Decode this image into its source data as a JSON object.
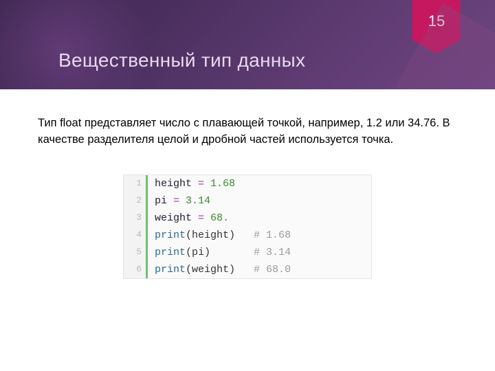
{
  "page_number": "15",
  "title": "Вещественный тип данных",
  "paragraph": "Тип float представляет число с плавающей точкой, например, 1.2 или 34.76. В качестве разделителя целой и дробной частей используется точка.",
  "code": {
    "lines": [
      {
        "n": "1",
        "t": [
          {
            "c": "tk-n",
            "s": "height "
          },
          {
            "c": "tk-o",
            "s": "="
          },
          {
            "c": "tk-n",
            "s": " "
          },
          {
            "c": "tk-num",
            "s": "1.68"
          }
        ]
      },
      {
        "n": "2",
        "t": [
          {
            "c": "tk-n",
            "s": "pi "
          },
          {
            "c": "tk-o",
            "s": "="
          },
          {
            "c": "tk-n",
            "s": " "
          },
          {
            "c": "tk-num",
            "s": "3.14"
          }
        ]
      },
      {
        "n": "3",
        "t": [
          {
            "c": "tk-n",
            "s": "weight "
          },
          {
            "c": "tk-o",
            "s": "="
          },
          {
            "c": "tk-n",
            "s": " "
          },
          {
            "c": "tk-num",
            "s": "68."
          }
        ]
      },
      {
        "n": "4",
        "t": [
          {
            "c": "tk-f",
            "s": "print"
          },
          {
            "c": "tk-p",
            "s": "(height)   "
          },
          {
            "c": "tk-c",
            "s": "# 1.68"
          }
        ]
      },
      {
        "n": "5",
        "t": [
          {
            "c": "tk-f",
            "s": "print"
          },
          {
            "c": "tk-p",
            "s": "(pi)       "
          },
          {
            "c": "tk-c",
            "s": "# 3.14"
          }
        ]
      },
      {
        "n": "6",
        "t": [
          {
            "c": "tk-f",
            "s": "print"
          },
          {
            "c": "tk-p",
            "s": "(weight)   "
          },
          {
            "c": "tk-c",
            "s": "# 68.0"
          }
        ]
      }
    ]
  }
}
